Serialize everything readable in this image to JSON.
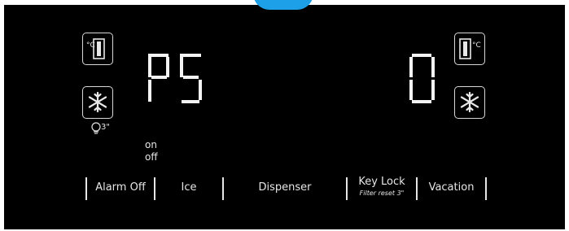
{
  "display": {
    "left_value": "P5",
    "right_value": "0"
  },
  "icons": {
    "left_fridge_unit": "°C",
    "right_freezer_unit": "°C",
    "timer_label": "3\""
  },
  "ice_status": {
    "on": "on",
    "off": "off"
  },
  "buttons": {
    "alarm_off": "Alarm Off",
    "ice": "Ice",
    "dispenser": "Dispenser",
    "key_lock": "Key Lock",
    "key_lock_sub": "Filter reset 3\"",
    "vacation": "Vacation"
  },
  "colors": {
    "panel": "#000000",
    "segment": "#f4f4f4",
    "accent": "#1ea0e8",
    "text": "#e6e6e6"
  }
}
